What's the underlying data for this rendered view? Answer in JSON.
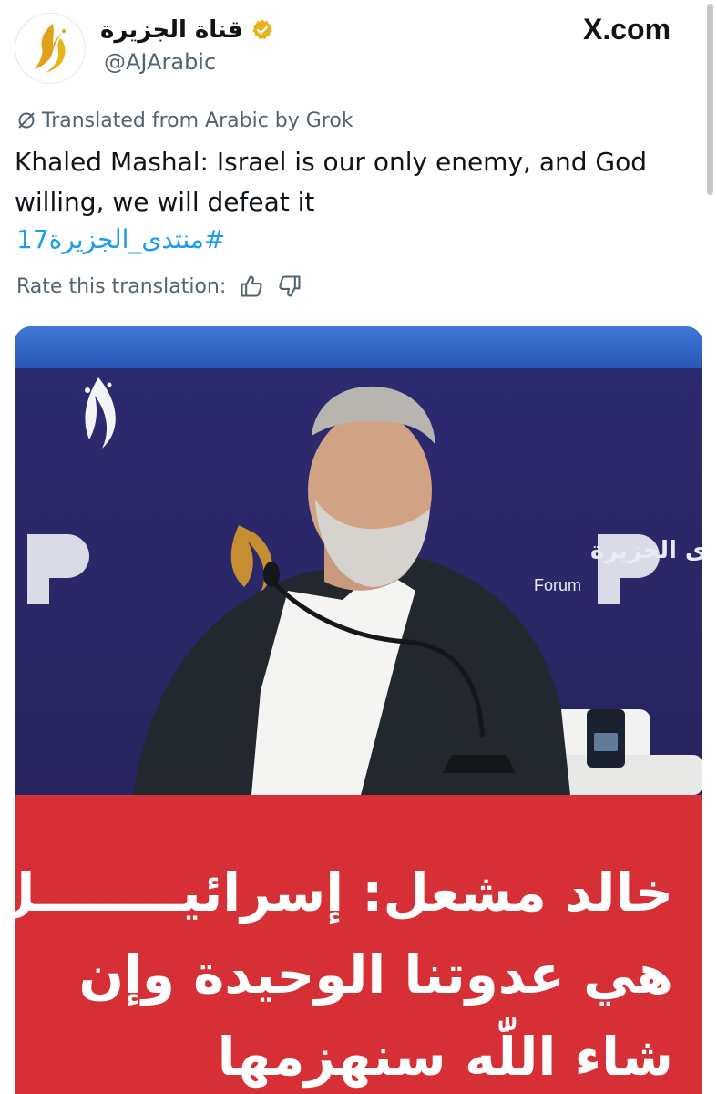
{
  "header": {
    "display_name": "قناة الجزيرة",
    "handle": "@AJArabic",
    "site": "X.com",
    "verified_color": "#e8b417"
  },
  "translation": {
    "note": "Translated from Arabic by Grok",
    "text": "Khaled Mashal: Israel is our only enemy, and God willing, we will defeat it",
    "hashtag": "#منتدى_الجزيرة17",
    "rate_label": "Rate this translation:",
    "thumbs_up_icon": "thumbs-up-icon",
    "thumbs_down_icon": "thumbs-down-icon"
  },
  "media": {
    "backdrop_text": "منتدى الجزيرة",
    "backdrop_subtext": "Forum",
    "headline_lines": [
      "خالد مشعل: إسرائيــــــــل",
      "هي عدوتنا الوحيدة وإن",
      "شاء اللّٰه سنهزمها"
    ],
    "panel_color": "#d62f35"
  },
  "colors": {
    "link": "#1d9bf0",
    "muted": "#536471",
    "backdrop": "#2d2a6e"
  }
}
